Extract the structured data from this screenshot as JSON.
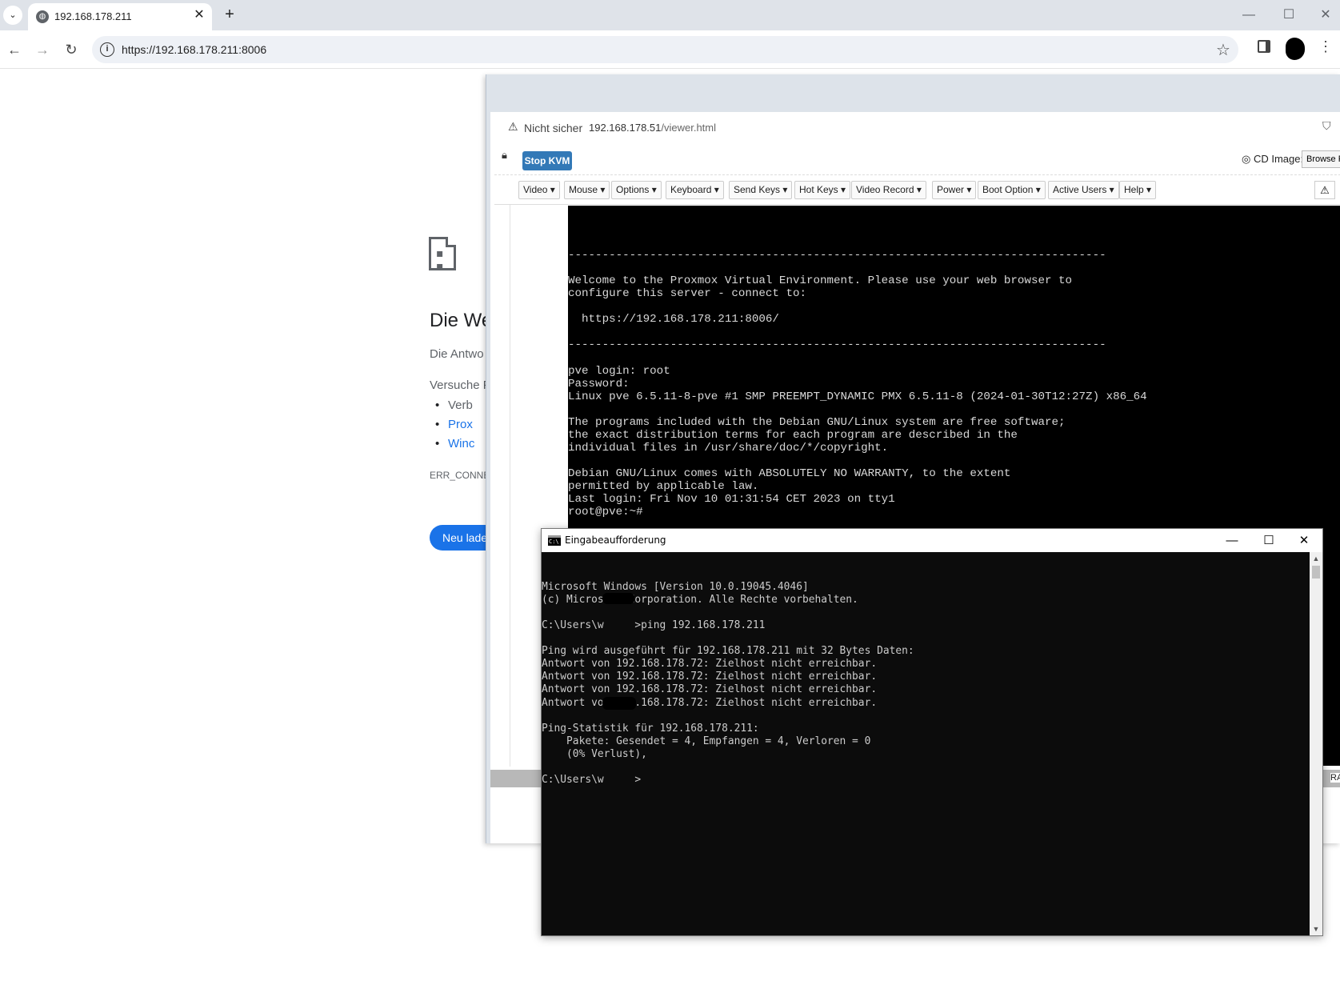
{
  "chrome": {
    "tab_title": "192.168.178.211",
    "url": "https://192.168.178.211:8006",
    "new_tab": "+",
    "tab_close": "✕"
  },
  "error_page": {
    "title": "Die We",
    "desc": "Die Antwo",
    "try": "Versuche F",
    "items": [
      {
        "text": "Verb",
        "color": "#5f6368"
      },
      {
        "text": "Prox",
        "color": "#1a73e8"
      },
      {
        "text": "Winc",
        "color": "#1a73e8"
      }
    ],
    "code": "ERR_CONNEC",
    "reload": "Neu laden"
  },
  "kvm_browser": {
    "not_secure": "Nicht sicher",
    "url_host": "192.168.178.51",
    "url_path": "/viewer.html",
    "stop_kvm": "Stop KVM",
    "cd_image_label": "CD Image:",
    "browse": "Browse Fi",
    "menus": [
      "Video ▾",
      "Mouse ▾",
      "Options ▾",
      "Keyboard ▾",
      "Send Keys ▾",
      "Hot Keys ▾",
      "Video Record ▾",
      "Power ▾",
      "Boot Option ▾",
      "Active Users ▾",
      "Help ▾"
    ],
    "ralt": "RALT",
    "console_lines": [
      "-------------------------------------------------------------------------------",
      "",
      "Welcome to the Proxmox Virtual Environment. Please use your web browser to",
      "configure this server - connect to:",
      "",
      "  https://192.168.178.211:8006/",
      "",
      "-------------------------------------------------------------------------------",
      "",
      "pve login: root",
      "Password:",
      "Linux pve 6.5.11-8-pve #1 SMP PREEMPT_DYNAMIC PMX 6.5.11-8 (2024-01-30T12:27Z) x86_64",
      "",
      "The programs included with the Debian GNU/Linux system are free software;",
      "the exact distribution terms for each program are described in the",
      "individual files in /usr/share/doc/*/copyright.",
      "",
      "Debian GNU/Linux comes with ABSOLUTELY NO WARRANTY, to the extent",
      "permitted by applicable law.",
      "Last login: Fri Nov 10 01:31:54 CET 2023 on tty1",
      "root@pve:~#"
    ]
  },
  "cmd": {
    "title": "Eingabeaufforderung",
    "lines": [
      "Microsoft Windows [Version 10.0.19045.4046]",
      "(c) Microsoft Corporation. Alle Rechte vorbehalten.",
      "",
      "C:\\Users\\w     >ping 192.168.178.211",
      "",
      "Ping wird ausgeführt für 192.168.178.211 mit 32 Bytes Daten:",
      "Antwort von 192.168.178.72: Zielhost nicht erreichbar.",
      "Antwort von 192.168.178.72: Zielhost nicht erreichbar.",
      "Antwort von 192.168.178.72: Zielhost nicht erreichbar.",
      "Antwort von 192.168.178.72: Zielhost nicht erreichbar.",
      "",
      "Ping-Statistik für 192.168.178.211:",
      "    Pakete: Gesendet = 4, Empfangen = 4, Verloren = 0",
      "    (0% Verlust),",
      "",
      "C:\\Users\\w     >"
    ]
  }
}
